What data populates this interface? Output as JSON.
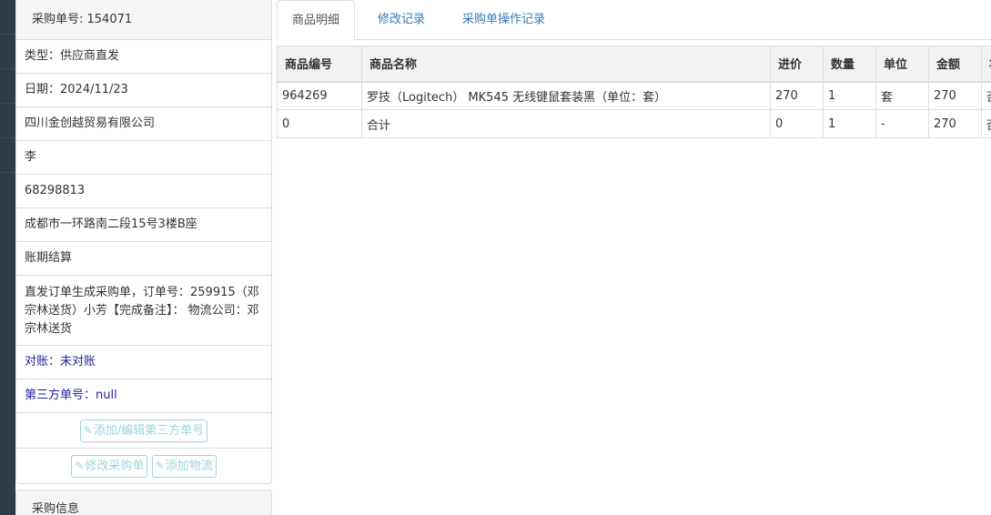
{
  "order": {
    "number_label": "采购单号: 154071",
    "type": "类型：供应商直发",
    "date": "日期：2024/11/23",
    "company": "四川金创越贸易有限公司",
    "contact": "李",
    "phone": "68298813",
    "address": "成都市一环路南二段15号3楼B座",
    "payment": "账期结算",
    "remark": "直发订单生成采购单，订单号：259915（邓宗林送货）小芳【完成备注】： 物流公司：邓宗林送货",
    "reconcile": "对账：未对账",
    "third_party": "第三方单号：null"
  },
  "buttons": {
    "add_edit_third_party": "添加/编辑第三方单号",
    "modify_order": "修改采购单",
    "add_logistics": "添加物流"
  },
  "purchase_info_heading": "采购信息",
  "tabs": [
    {
      "label": "商品明细",
      "active": true
    },
    {
      "label": "修改记录",
      "active": false
    },
    {
      "label": "采购单操作记录",
      "active": false
    }
  ],
  "table": {
    "headers": [
      "商品编号",
      "商品名称",
      "进价",
      "数量",
      "单位",
      "金额",
      "状"
    ],
    "rows": [
      [
        "964269",
        "罗技（Logitech） MK545 无线键鼠套装黑（单位：套）",
        "270",
        "1",
        "套",
        "270",
        "否"
      ],
      [
        "0",
        "合计",
        "0",
        "1",
        "-",
        "270",
        "否"
      ]
    ]
  },
  "icons": {
    "edit": "edit-icon"
  }
}
